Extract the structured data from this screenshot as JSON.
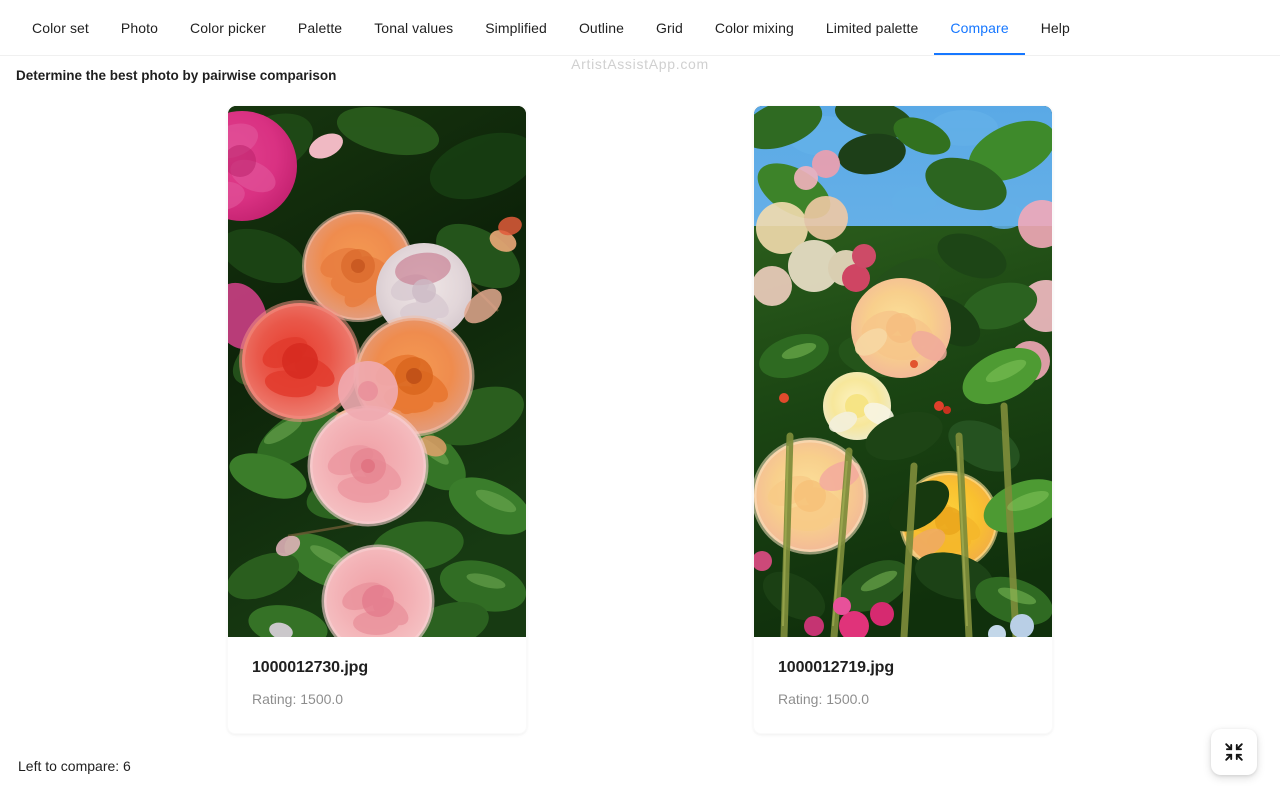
{
  "nav": {
    "items": [
      {
        "label": "Color set",
        "active": false
      },
      {
        "label": "Photo",
        "active": false
      },
      {
        "label": "Color picker",
        "active": false
      },
      {
        "label": "Palette",
        "active": false
      },
      {
        "label": "Tonal values",
        "active": false
      },
      {
        "label": "Simplified",
        "active": false
      },
      {
        "label": "Outline",
        "active": false
      },
      {
        "label": "Grid",
        "active": false
      },
      {
        "label": "Color mixing",
        "active": false
      },
      {
        "label": "Limited palette",
        "active": false
      },
      {
        "label": "Compare",
        "active": true
      },
      {
        "label": "Help",
        "active": false
      }
    ],
    "active_color": "#1677ff"
  },
  "watermark": {
    "text": "ArtistAssistApp.com",
    "color": "#d0d0d0"
  },
  "page": {
    "subtitle": "Determine the best photo by pairwise comparison",
    "status": "Left to compare: 6"
  },
  "cards": [
    {
      "filename": "1000012730.jpg",
      "rating": "Rating: 1500.0",
      "photo_alt": "close-up of a rose bush with pink, coral and orange roses among dark green leaves"
    },
    {
      "filename": "1000012719.jpg",
      "rating": "Rating: 1500.0",
      "photo_alt": "tall rose bush with yellow and peach roses against blue sky and green foliage"
    }
  ],
  "fab": {
    "icon": "compress-icon",
    "label": "Exit full screen"
  }
}
